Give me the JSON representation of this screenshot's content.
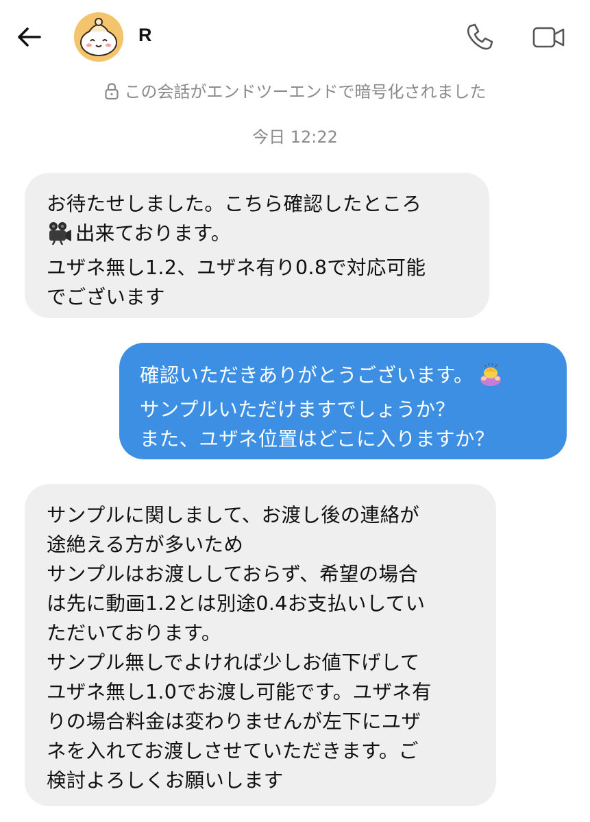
{
  "header": {
    "contact_name": "R",
    "back_icon": "arrow-left-icon",
    "call_icon": "phone-icon",
    "video_icon": "video-camera-icon",
    "avatar_icon": "cartoon-mascot-avatar"
  },
  "encryption_notice": "この会話がエンドツーエンドで暗号化されました",
  "date_label": "今日 12:22",
  "colors": {
    "incoming_bubble": "#efefef",
    "outgoing_bubble": "#3d8fe4",
    "meta_text": "#8a8a8a"
  },
  "messages": [
    {
      "direction": "incoming",
      "lines": [
        "お待たせしました。こちら確認したところ",
        "出来ております。",
        "ユザネ無し1.2、ユザネ有り0.8で対応可能",
        "でございます"
      ],
      "emoji": "movie-camera-emoji"
    },
    {
      "direction": "outgoing",
      "lines": [
        "確認いただきありがとうございます。",
        "サンプルいただけますでしょうか？",
        "また、ユザネ位置はどこに入りますか？"
      ],
      "emoji": "person-bowing-emoji"
    },
    {
      "direction": "incoming",
      "lines": [
        "サンプルに関しまして、お渡し後の連絡が",
        "途絶える方が多いため",
        "サンプルはお渡ししておらず、希望の場合",
        "は先に動画1.2とは別途0.4お支払いしてい",
        "ただいております。",
        "サンプル無しでよければ少しお値下げして",
        "ユザネ無し1.0でお渡し可能です。ユザネ有",
        "りの場合料金は変わりませんが左下にユザ",
        "ネを入れてお渡しさせていただきます。ご",
        "検討よろしくお願いします"
      ]
    }
  ]
}
